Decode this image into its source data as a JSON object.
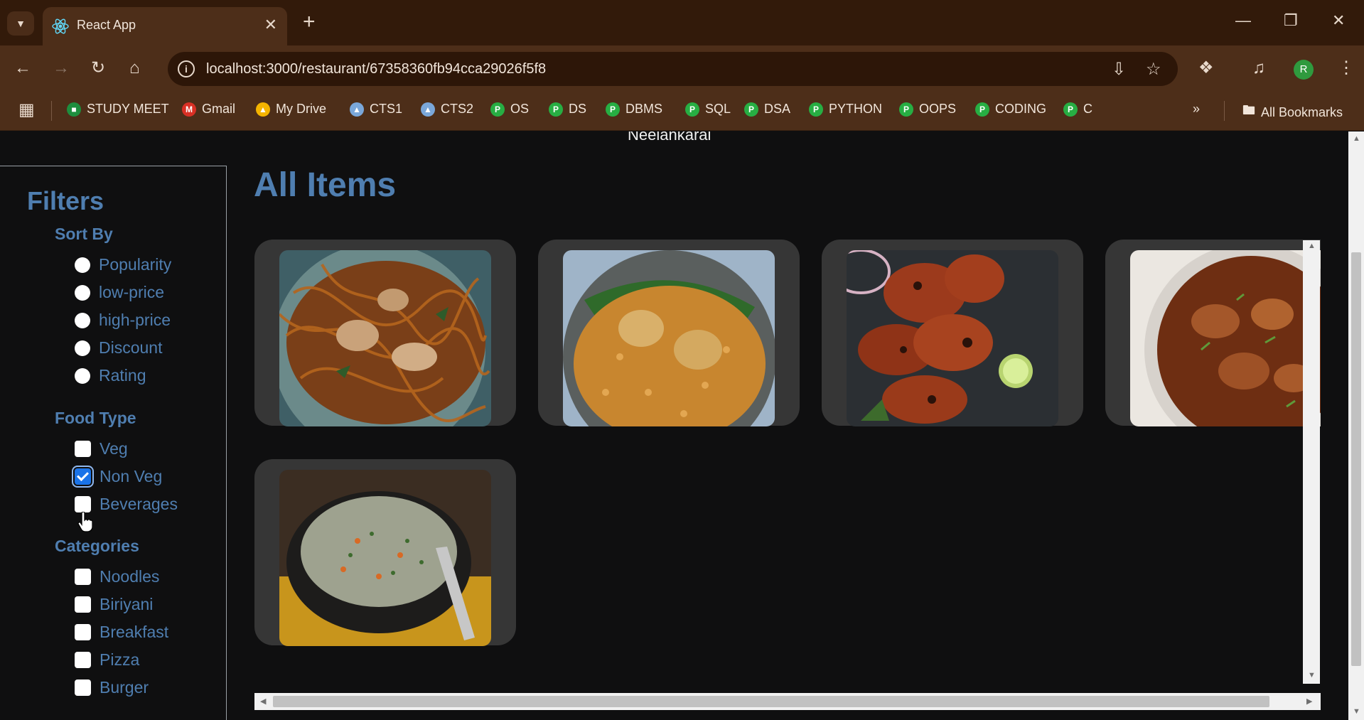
{
  "browser": {
    "tab_title": "React App",
    "url": "localhost:3000/restaurant/67358360fb94cca29026f5f8",
    "profile_initial": "R",
    "bookmarks": [
      {
        "label": "STUDY MEET",
        "icon": "meet-icon"
      },
      {
        "label": "Gmail",
        "icon": "gmail-icon"
      },
      {
        "label": "My Drive",
        "icon": "drive-icon"
      },
      {
        "label": "CTS1",
        "icon": "cts-icon"
      },
      {
        "label": "CTS2",
        "icon": "cts-icon"
      },
      {
        "label": "OS",
        "icon": "p-icon"
      },
      {
        "label": "DS",
        "icon": "p-icon"
      },
      {
        "label": "DBMS",
        "icon": "p-icon"
      },
      {
        "label": "SQL",
        "icon": "p-icon"
      },
      {
        "label": "DSA",
        "icon": "p-icon"
      },
      {
        "label": "PYTHON",
        "icon": "p-icon"
      },
      {
        "label": "OOPS",
        "icon": "p-icon"
      },
      {
        "label": "CODING",
        "icon": "p-icon"
      },
      {
        "label": "C",
        "icon": "p-icon"
      }
    ],
    "all_bookmarks": "All Bookmarks"
  },
  "restaurant": {
    "location": "Neelankarai"
  },
  "filters": {
    "title": "Filters",
    "sort_by": {
      "title": "Sort By",
      "options": [
        "Popularity",
        "low-price",
        "high-price",
        "Discount",
        "Rating"
      ]
    },
    "food_type": {
      "title": "Food Type",
      "options": [
        {
          "label": "Veg",
          "checked": false
        },
        {
          "label": "Non Veg",
          "checked": true
        },
        {
          "label": "Beverages",
          "checked": false
        }
      ]
    },
    "categories": {
      "title": "Categories",
      "options": [
        {
          "label": "Noodles",
          "checked": false
        },
        {
          "label": "Biriyani",
          "checked": false
        },
        {
          "label": "Breakfast",
          "checked": false
        },
        {
          "label": "Pizza",
          "checked": false
        },
        {
          "label": "Burger",
          "checked": false
        }
      ]
    }
  },
  "main": {
    "heading": "All Items",
    "items": [
      {
        "name": "noodles-image"
      },
      {
        "name": "biriyani-image"
      },
      {
        "name": "tandoori-chicken-image"
      },
      {
        "name": "chicken-curry-image"
      },
      {
        "name": "chicken-soup-image"
      }
    ]
  },
  "colors": {
    "accent": "#4f7eb0",
    "card": "#363636",
    "background": "#0f0f10",
    "chrome": "#4d2e19"
  }
}
